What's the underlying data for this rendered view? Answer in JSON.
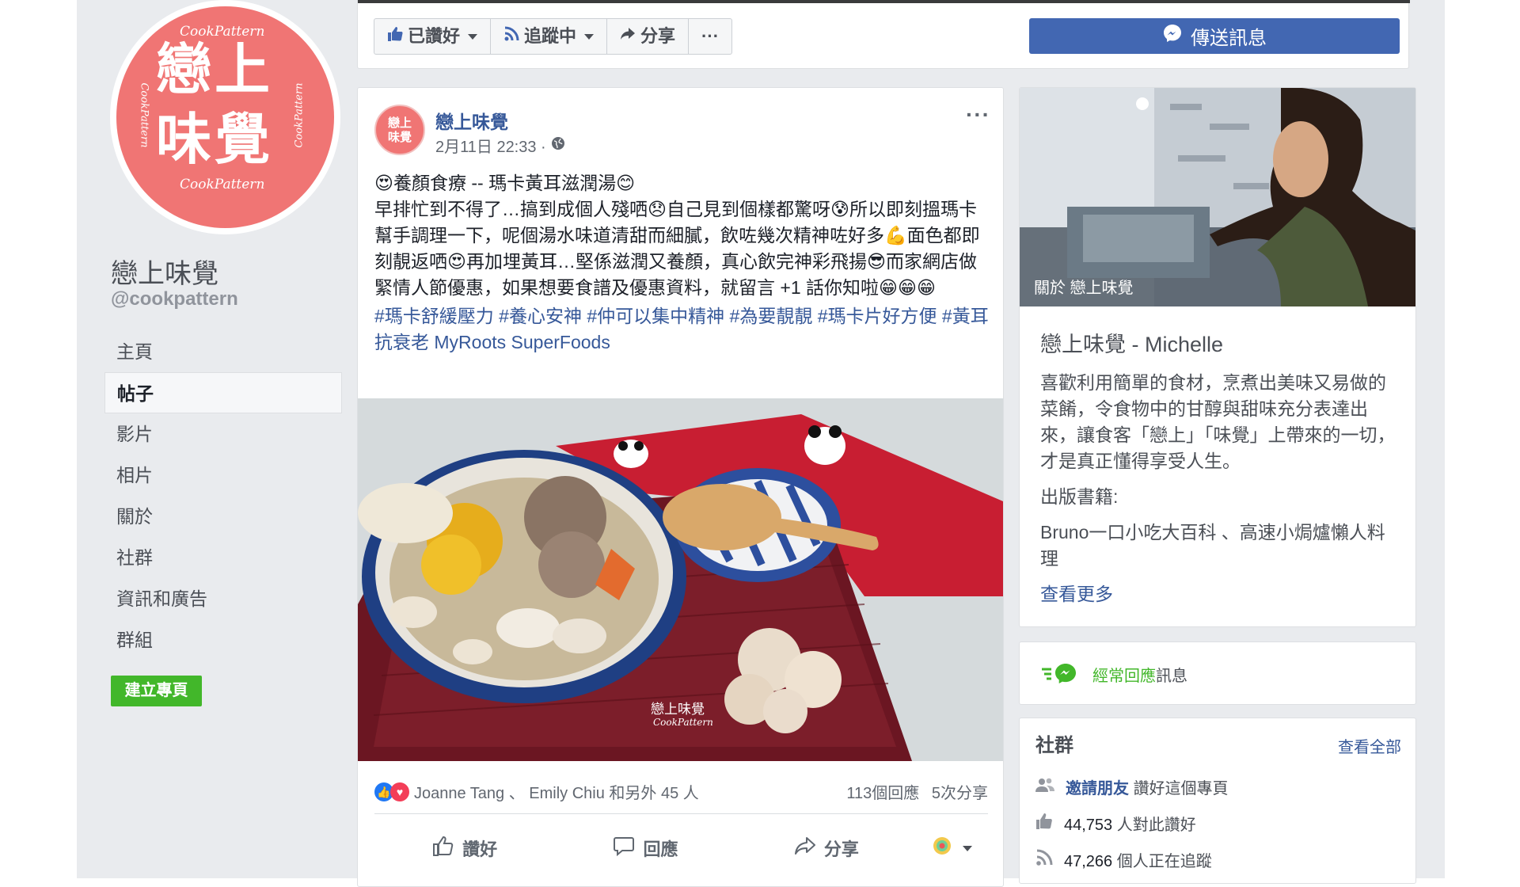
{
  "page": {
    "name": "戀上味覺",
    "handle": "@cookpattern",
    "logo": {
      "top_text": "CookPattern",
      "bottom_text": "CookPattern",
      "line1": "戀上",
      "line2": "味覺",
      "side_left": "CookPattern",
      "side_right": "CookPattern"
    }
  },
  "nav": {
    "items": [
      "主頁",
      "帖子",
      "影片",
      "相片",
      "關於",
      "社群",
      "資訊和廣告",
      "群組"
    ],
    "active_index": 1,
    "create_page": "建立專頁"
  },
  "actionbar": {
    "liked": "已讚好",
    "following": "追蹤中",
    "share": "分享",
    "more": "···",
    "send_message": "傳送訊息"
  },
  "post": {
    "author": "戀上味覺",
    "avatar_line1": "戀上",
    "avatar_line2": "味覺",
    "timestamp": "2月11日 22:33 ·",
    "more": "···",
    "lines": [
      "😍養顏食療 -- 瑪卡黃耳滋潤湯😊",
      "早排忙到不得了…搞到成個人殘哂😞自己見到個樣都驚呀😰所以即刻搵瑪卡幫手調理一下，呢個湯水味道清甜而細膩，飲咗幾次精神咗好多💪面色都即刻靚返哂😍再加埋黃耳…堅係滋潤又養顏，真心飲完神彩飛揚😎而家網店做緊情人節優惠，如果想要食譜及優惠資料，就留言 +1 話你知啦😁😁😁"
    ],
    "hashtags": "#瑪卡舒緩壓力 #養心安神 #仲可以集中精神 #為要靚靚 #瑪卡片好方便 #黃耳抗衰老 MyRoots SuperFoods",
    "image_watermark_1": "戀上味覺",
    "image_watermark_2": "CookPattern",
    "reactions_text": "Joanne Tang 、 Emily Chiu 和另外 45 人",
    "comments": "113個回應",
    "shares": "5次分享",
    "actions": {
      "like": "讚好",
      "comment": "回應",
      "share": "分享"
    }
  },
  "about": {
    "photo_label": "關於 戀上味覺",
    "title": "戀上味覺 - Michelle",
    "description": "喜歡利用簡單的食材，烹煮出美味又易做的菜餚，令食物中的甘醇與甜味充分表達出來，讓食客「戀上」「味覺」上帶來的一切，才是真正懂得享受人生。",
    "books_label": "出版書籍:",
    "books": "Bruno一口小吃大百科 、高速小焗爐懶人料理",
    "see_more": "查看更多"
  },
  "responsiveness": {
    "highlight": "經常回應",
    "rest": "訊息"
  },
  "community": {
    "title": "社群",
    "see_all": "查看全部",
    "invite_link": "邀請朋友",
    "invite_rest": "讚好這個專頁",
    "likes_count": "44,753",
    "likes_rest": "人對此讚好",
    "follows_count": "47,266",
    "follows_rest": "個人正在追蹤"
  },
  "colors": {
    "facebook_blue": "#4267b2",
    "link_blue": "#365899",
    "logo_pink": "#f07574",
    "green": "#42b72a",
    "background": "#e9ebee"
  }
}
